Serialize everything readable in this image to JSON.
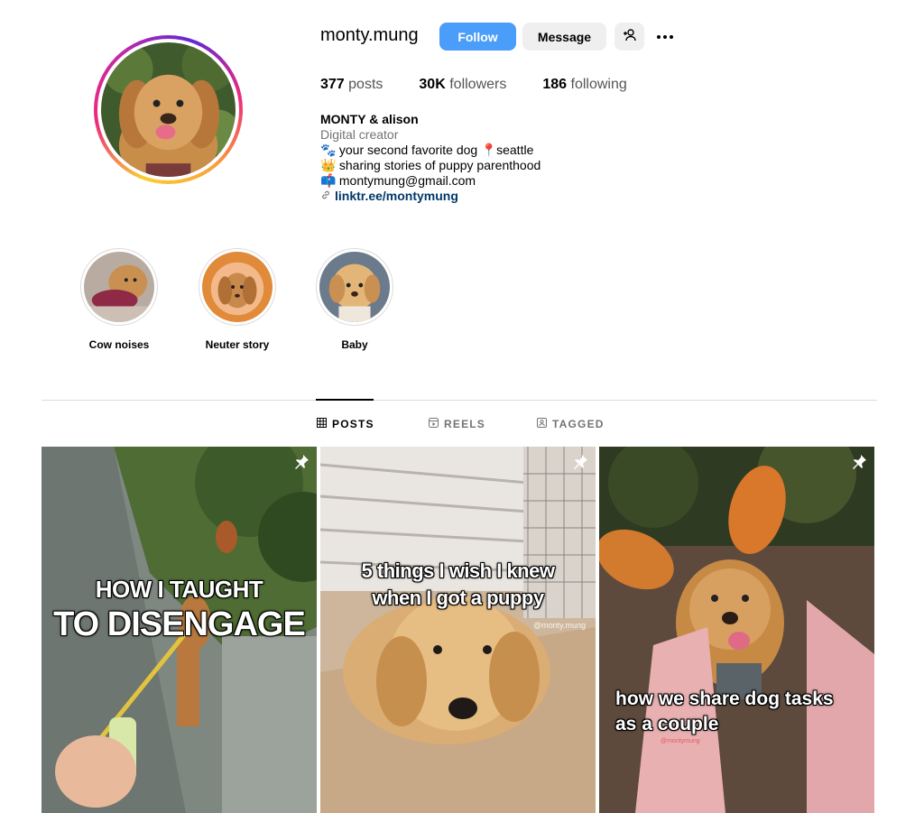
{
  "profile": {
    "username": "monty.mung",
    "follow_label": "Follow",
    "message_label": "Message",
    "stats": [
      {
        "value": "377",
        "label": "posts"
      },
      {
        "value": "30K",
        "label": "followers"
      },
      {
        "value": "186",
        "label": "following"
      }
    ],
    "bio": {
      "name": "MONTY & alison",
      "category": "Digital creator",
      "line1_emoji": "🐾",
      "line1_text": "your second favorite dog",
      "line1_pin": "📍",
      "line1_place": "seattle",
      "line2_emoji": "👑",
      "line2_text": "sharing stories of puppy parenthood",
      "line3_emoji": "📫",
      "line3_text": "montymung@gmail.com",
      "link": "linktr.ee/montymung"
    }
  },
  "highlights": [
    {
      "label": "Cow noises"
    },
    {
      "label": "Neuter story"
    },
    {
      "label": "Baby"
    }
  ],
  "tabs": [
    {
      "label": "POSTS",
      "icon": "grid-icon",
      "active": true
    },
    {
      "label": "REELS",
      "icon": "reels-icon",
      "active": false
    },
    {
      "label": "TAGGED",
      "icon": "tagged-icon",
      "active": false
    }
  ],
  "posts": [
    {
      "caption_line1": "HOW I TAUGHT",
      "caption_line2": "TO DISENGAGE",
      "pinned": true
    },
    {
      "caption_line1": "5 things I wish I knew",
      "caption_line2": "when I got a puppy",
      "watermark": "@monty.mung",
      "pinned": true
    },
    {
      "caption_line1": "how we share dog tasks",
      "caption_line2": "as a couple",
      "watermark": "@montymung",
      "pinned": true
    }
  ],
  "colors": {
    "follow_button": "#4a9df8",
    "link": "#00376b",
    "secondary_text": "#737373"
  }
}
